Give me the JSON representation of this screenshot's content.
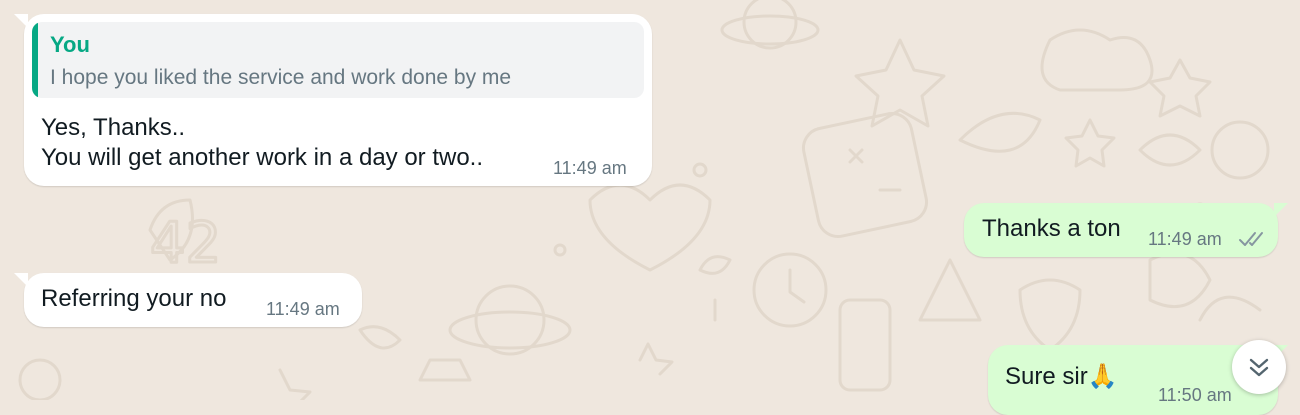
{
  "chat": {
    "messages": [
      {
        "direction": "incoming",
        "quote": {
          "author": "You",
          "text": "I hope you liked the service and work done by me"
        },
        "lines": [
          "Yes, Thanks..",
          "You will get another work in a day or two.."
        ],
        "time": "11:49 am"
      },
      {
        "direction": "outgoing",
        "text": "Thanks a ton",
        "time": "11:49 am",
        "status": "read"
      },
      {
        "direction": "incoming",
        "text": "Referring your no",
        "time": "11:49 am"
      },
      {
        "direction": "outgoing",
        "text": "Sure sir🙏",
        "time": "11:50 am",
        "status": "delivered"
      }
    ]
  },
  "colors": {
    "wallpaper": "#efe7de",
    "incoming_bubble": "#ffffff",
    "outgoing_bubble": "#d9fdd3",
    "quote_accent": "#06a884",
    "timestamp": "#667781"
  },
  "icons": {
    "read_receipt": "double-check-icon",
    "scroll_down": "double-chevron-down-icon"
  }
}
